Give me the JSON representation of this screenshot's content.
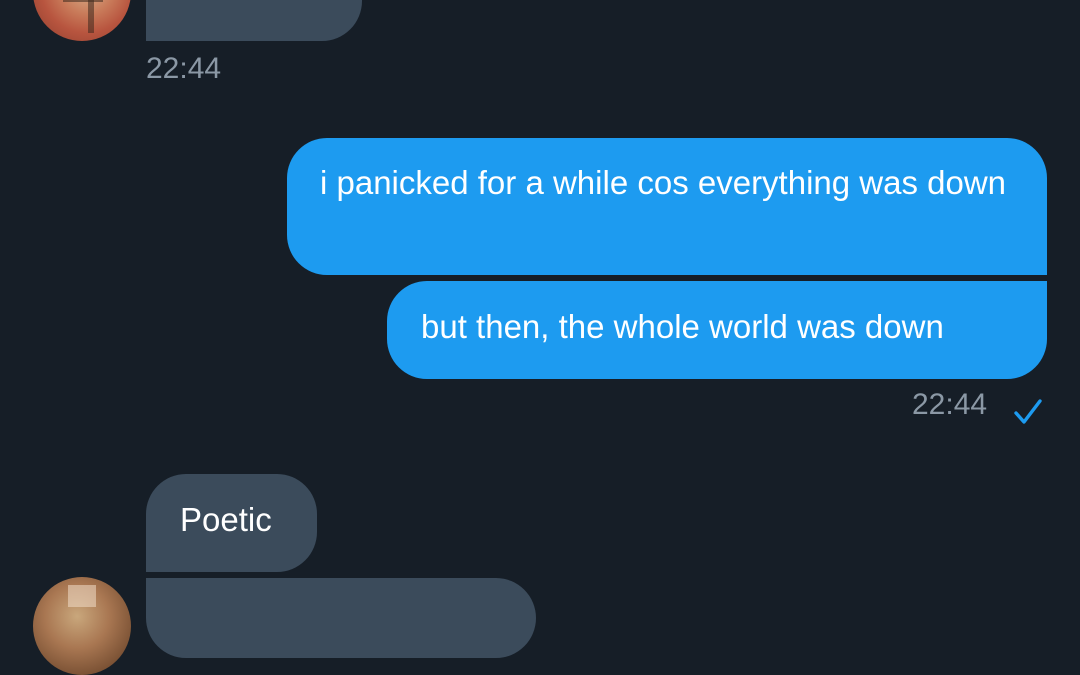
{
  "conversation": {
    "received_group_1": {
      "time": "22:44"
    },
    "sent_group": {
      "messages": [
        {
          "text": "i panicked for a while cos everything was down"
        },
        {
          "text": "but then, the whole world was down"
        }
      ],
      "time": "22:44",
      "status_icon": "single-check-icon"
    },
    "received_group_2": {
      "messages": [
        {
          "text": "Poetic"
        }
      ]
    }
  },
  "colors": {
    "background": "#161e27",
    "incoming_bubble": "#3b4b5b",
    "outgoing_bubble": "#1d9bf0",
    "timestamp": "#8b98a5",
    "check": "#1d9bf0"
  }
}
